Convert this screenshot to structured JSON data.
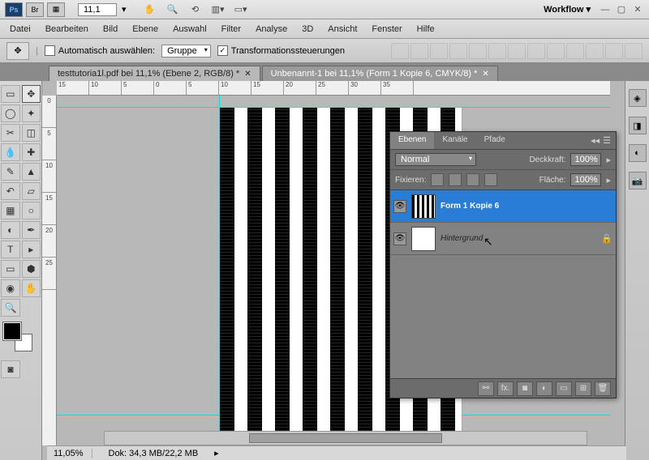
{
  "titlebar": {
    "zoom_value": "11,1",
    "workflow_label": "Workflow ▾"
  },
  "menu": {
    "items": [
      "Datei",
      "Bearbeiten",
      "Bild",
      "Ebene",
      "Auswahl",
      "Filter",
      "Analyse",
      "3D",
      "Ansicht",
      "Fenster",
      "Hilfe"
    ]
  },
  "options": {
    "auto_select_label": "Automatisch auswählen:",
    "group_label": "Gruppe",
    "transform_label": "Transformationssteuerungen"
  },
  "tabs": [
    {
      "label": "testtutoria1l.pdf bei 11,1% (Ebene 2, RGB/8) *",
      "active": false
    },
    {
      "label": "Unbenannt-1 bei 11,1% (Form 1 Kopie 6, CMYK/8) *",
      "active": true
    }
  ],
  "ruler_h": [
    "15",
    "10",
    "5",
    "0",
    "5",
    "10",
    "15",
    "20",
    "25",
    "30",
    "35"
  ],
  "ruler_v": [
    "0",
    "5",
    "10",
    "15",
    "20",
    "25"
  ],
  "status": {
    "zoom": "11,05%",
    "doc": "Dok: 34,3 MB/22,2 MB"
  },
  "layers_panel": {
    "tabs": [
      "Ebenen",
      "Kanäle",
      "Pfade"
    ],
    "blend_mode": "Normal",
    "opacity_label": "Deckkraft:",
    "opacity_value": "100%",
    "lock_label": "Fixieren:",
    "fill_label": "Fläche:",
    "fill_value": "100%",
    "layers": [
      {
        "name": "Form 1 Kopie 6",
        "locked": false,
        "selected": true,
        "thumb": "stripes"
      },
      {
        "name": "Hintergrund",
        "locked": true,
        "selected": false,
        "thumb": "plain"
      }
    ]
  }
}
